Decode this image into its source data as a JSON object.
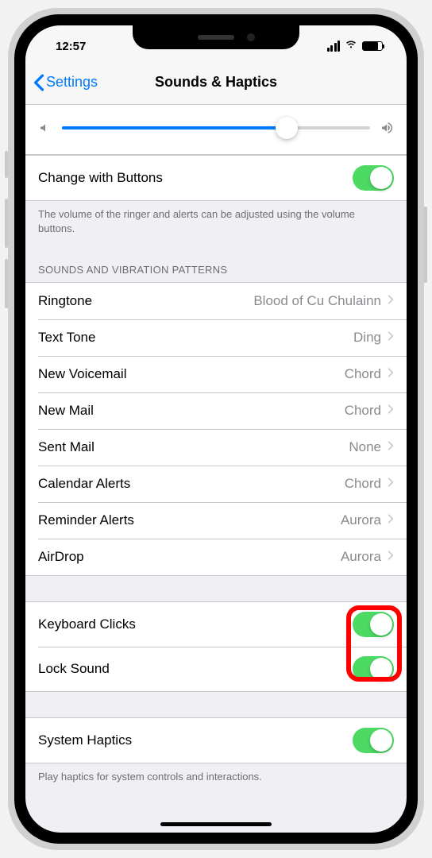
{
  "status": {
    "time": "12:57"
  },
  "nav": {
    "back": "Settings",
    "title": "Sounds & Haptics"
  },
  "volume": {
    "change_with_buttons": "Change with Buttons"
  },
  "footer1": "The volume of the ringer and alerts can be adjusted using the volume buttons.",
  "header_patterns": "SOUNDS AND VIBRATION PATTERNS",
  "patterns": [
    {
      "label": "Ringtone",
      "value": "Blood of Cu Chulainn"
    },
    {
      "label": "Text Tone",
      "value": "Ding"
    },
    {
      "label": "New Voicemail",
      "value": "Chord"
    },
    {
      "label": "New Mail",
      "value": "Chord"
    },
    {
      "label": "Sent Mail",
      "value": "None"
    },
    {
      "label": "Calendar Alerts",
      "value": "Chord"
    },
    {
      "label": "Reminder Alerts",
      "value": "Aurora"
    },
    {
      "label": "AirDrop",
      "value": "Aurora"
    }
  ],
  "toggles2": {
    "keyboard_clicks": "Keyboard Clicks",
    "lock_sound": "Lock Sound"
  },
  "system_haptics": "System Haptics",
  "footer2": "Play haptics for system controls and interactions."
}
